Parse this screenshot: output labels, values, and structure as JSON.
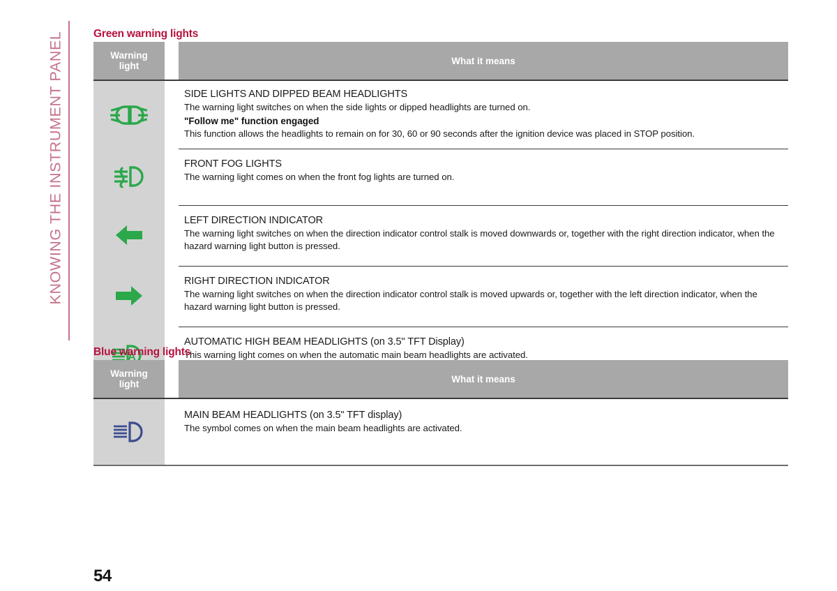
{
  "sidebar": {
    "chapter_label": "KNOWING THE INSTRUMENT PANEL",
    "rule_color": "#c4738a"
  },
  "page": {
    "number": "54",
    "accent_red": "#b5123e",
    "green": "#2aa84a",
    "blue": "#3b4d8f",
    "header_gray": "#a8a8a8",
    "icon_cell_gray": "#d3d3d3"
  },
  "sections": [
    {
      "id": "green",
      "title": "Green warning lights",
      "columns": {
        "icon_line1": "Warning",
        "icon_line2": "light",
        "meaning": "What it means"
      },
      "rows": [
        {
          "icon_name": "side-lights-dipped-beam-icon",
          "lines": [
            {
              "style": "head",
              "text": "SIDE LIGHTS AND DIPPED BEAM HEADLIGHTS"
            },
            {
              "style": "body",
              "text": "The warning light switches on when the side lights or dipped headlights are turned on."
            },
            {
              "style": "bold",
              "text": "\"Follow me\" function engaged"
            },
            {
              "style": "body",
              "text": "This function allows the headlights to remain on for 30, 60 or 90 seconds after the ignition device was placed in STOP position."
            }
          ]
        },
        {
          "icon_name": "front-fog-lights-icon",
          "lines": [
            {
              "style": "head",
              "text": "FRONT FOG LIGHTS"
            },
            {
              "style": "body",
              "text": "The warning light comes on when the front fog lights are turned on."
            }
          ]
        },
        {
          "icon_name": "left-direction-indicator-icon",
          "lines": [
            {
              "style": "head",
              "text": "LEFT DIRECTION INDICATOR"
            },
            {
              "style": "body",
              "text": "The warning light switches on when the direction indicator control stalk is moved downwards or, together with the right direction indicator, when the hazard warning light button is pressed."
            }
          ]
        },
        {
          "icon_name": "right-direction-indicator-icon",
          "lines": [
            {
              "style": "head",
              "text": "RIGHT DIRECTION INDICATOR"
            },
            {
              "style": "body",
              "text": "The warning light switches on when the direction indicator control stalk is moved upwards or, together with the left direction indicator, when the hazard warning light button is pressed."
            }
          ]
        },
        {
          "icon_name": "automatic-high-beam-headlights-icon",
          "lines": [
            {
              "style": "head",
              "text": "AUTOMATIC HIGH BEAM HEADLIGHTS (on 3.5\" TFT Display)"
            },
            {
              "style": "body",
              "text": "This warning light comes on when the automatic main beam headlights are activated."
            }
          ]
        }
      ]
    },
    {
      "id": "blue",
      "title": "Blue warning lights",
      "columns": {
        "icon_line1": "Warning",
        "icon_line2": "light",
        "meaning": "What it means"
      },
      "rows": [
        {
          "icon_name": "main-beam-headlights-icon",
          "lines": [
            {
              "style": "head",
              "text": "MAIN BEAM HEADLIGHTS (on 3.5\" TFT display)"
            },
            {
              "style": "body",
              "text": "The symbol comes on when the main beam headlights are activated."
            }
          ]
        }
      ]
    }
  ]
}
